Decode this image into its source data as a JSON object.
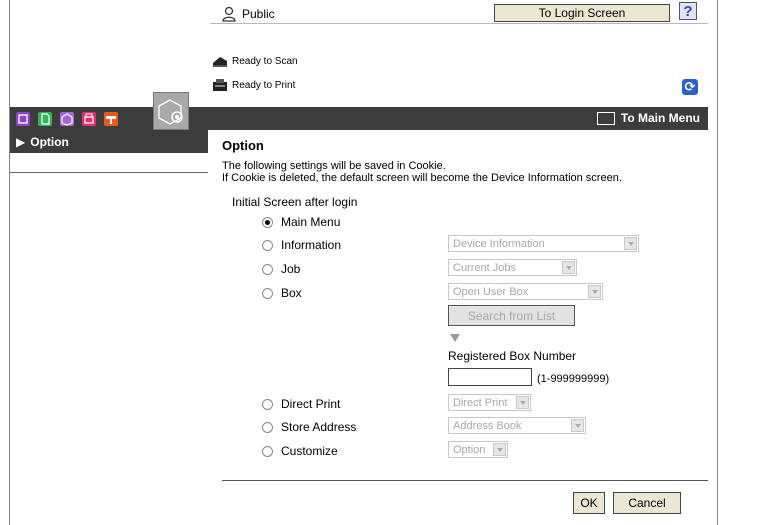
{
  "header": {
    "user": "Public",
    "login_button": "To Login Screen",
    "help_icon": "?",
    "icons": {
      "user": "user-icon",
      "help": "help-icon",
      "refresh": "refresh-icon"
    }
  },
  "status": [
    {
      "label": "Ready to Scan",
      "icon": "scanner-icon"
    },
    {
      "label": "Ready to Print",
      "icon": "printer-icon"
    }
  ],
  "tabs": [
    {
      "name": "information-tab-icon",
      "color": "#8b45c7"
    },
    {
      "name": "job-tab-icon",
      "color": "#33b35a"
    },
    {
      "name": "box-tab-icon",
      "color": "#a066d8"
    },
    {
      "name": "print-tab-icon",
      "color": "#e0306e"
    },
    {
      "name": "store-address-tab-icon",
      "color": "#e85a1c"
    },
    {
      "name": "settings-tab-icon",
      "color": "#a9a9a9"
    }
  ],
  "main_menu_link": "To Main Menu",
  "sidebar": {
    "item": "Option"
  },
  "main": {
    "title": "Option",
    "info_lines": [
      "The following settings will be saved in Cookie.",
      "If Cookie is deleted, the default screen will become the Device Information screen."
    ],
    "section_label": "Initial Screen after login",
    "options": [
      {
        "label": "Main Menu",
        "selected": true,
        "select": null
      },
      {
        "label": "Information",
        "selected": false,
        "select": "Device Information"
      },
      {
        "label": "Job",
        "selected": false,
        "select": "Current Jobs"
      },
      {
        "label": "Box",
        "selected": false,
        "select": "Open User Box"
      },
      {
        "label": "Direct Print",
        "selected": false,
        "select": "Direct Print"
      },
      {
        "label": "Store Address",
        "selected": false,
        "select": "Address Book"
      },
      {
        "label": "Customize",
        "selected": false,
        "select": "Option"
      }
    ],
    "search_button": "Search from List",
    "registered_box_label": "Registered Box Number",
    "registered_box_value": "",
    "registered_box_range": "(1-999999999)"
  },
  "buttons": {
    "ok": "OK",
    "cancel": "Cancel"
  }
}
